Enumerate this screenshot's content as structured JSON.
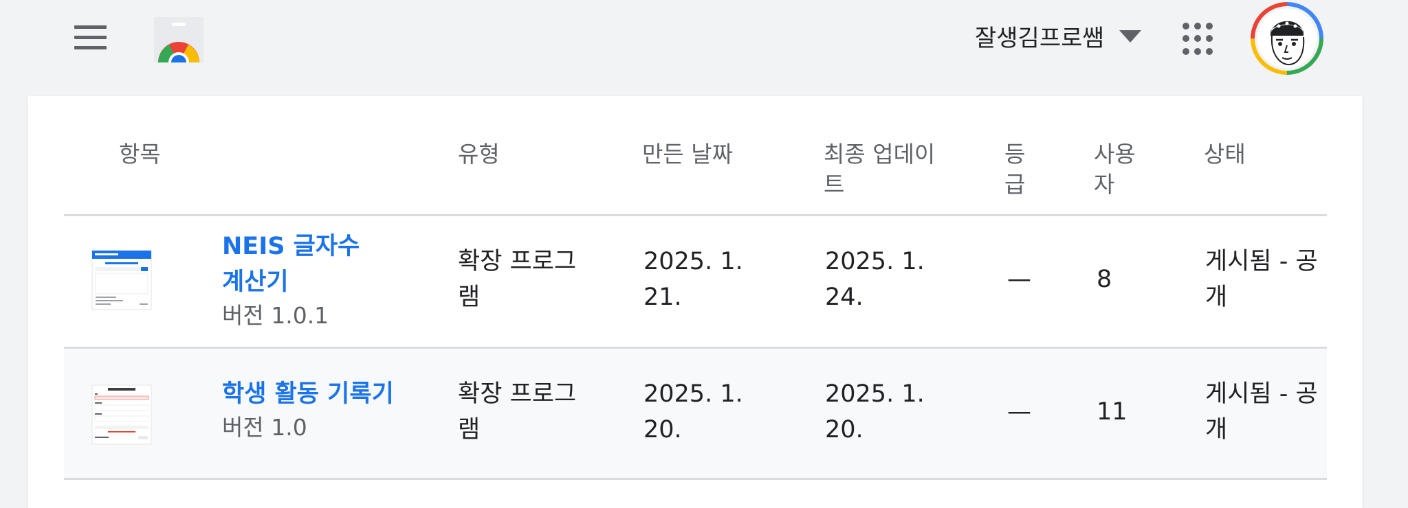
{
  "header": {
    "account_name": "잘생김프로쌤",
    "icons": {
      "menu": "hamburger-icon",
      "logo": "chrome-web-store-logo",
      "account_menu": "caret-down-icon",
      "apps": "apps-grid-icon",
      "avatar": "profile-avatar"
    }
  },
  "table": {
    "columns": {
      "item": "항목",
      "type": "유형",
      "created": "만든 날짜",
      "updated": "최종 업데이트",
      "rating": "등급",
      "users": "사용자",
      "status": "상태"
    },
    "rows": [
      {
        "name": "NEIS 글자수 계산기",
        "version": "버전 1.0.1",
        "type": "확장 프로그램",
        "created": "2025. 1. 21.",
        "updated": "2025. 1. 24.",
        "rating": "—",
        "users": "8",
        "status": "게시됨 - 공개"
      },
      {
        "name": "학생 활동 기록기",
        "version": "버전 1.0",
        "type": "확장 프로그램",
        "created": "2025. 1. 20.",
        "updated": "2025. 1. 20.",
        "rating": "—",
        "users": "11",
        "status": "게시됨 - 공개"
      }
    ]
  },
  "colors": {
    "background": "#f1f3f4",
    "link": "#1a73e8",
    "text": "#202124",
    "muted": "#5f6368",
    "divider": "#dadce0"
  }
}
